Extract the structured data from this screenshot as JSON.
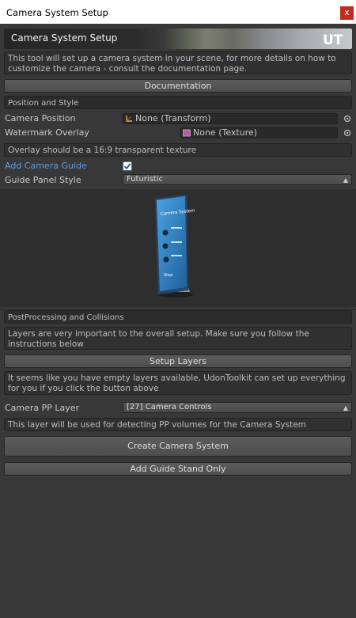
{
  "window": {
    "title": "Camera System Setup",
    "close_glyph": "x"
  },
  "banner": {
    "title": "Camera System Setup",
    "logo_icon": "udontoolkit-logo-icon",
    "logo_text": "UT"
  },
  "intro_help": "This tool will set up a camera system in your scene, for more details on how to customize the camera - consult the documentation page.",
  "buttons": {
    "documentation": "Documentation",
    "setup_layers": "Setup Layers",
    "create_camera_system": "Create Camera System",
    "add_guide_stand_only": "Add Guide Stand Only"
  },
  "sections": {
    "position_style": "Position and Style",
    "postprocessing": "PostProcessing and Collisions"
  },
  "fields": {
    "camera_position": {
      "label": "Camera Position",
      "value": "None (Transform)",
      "icon": "transform-icon"
    },
    "watermark_overlay": {
      "label": "Watermark Overlay",
      "value": "None (Texture)",
      "icon": "texture-icon"
    }
  },
  "overlay_help": "Overlay should be a 16:9 transparent texture",
  "add_camera_guide": {
    "label": "Add Camera Guide",
    "checked": true
  },
  "guide_panel_style": {
    "label": "Guide Panel Style",
    "value": "Futuristic"
  },
  "preview": {
    "panel_title": "Camera System",
    "panel_sub": "Step"
  },
  "layers_help": "Layers are very important to the overall setup. Make sure you follow the instructions below",
  "empty_layers_help": "It seems like you have empty layers available, UdonToolkit can set up everything for you if you click the button above",
  "camera_pp_layer": {
    "label": "Camera PP Layer",
    "value": "[27] Camera Controls"
  },
  "pp_layer_help": "This layer will be used for detecting PP volumes for the Camera System",
  "colors": {
    "accent_link": "#5e9fe0",
    "close_button": "#c42b1c",
    "panel_blue": "#2f86c8"
  }
}
